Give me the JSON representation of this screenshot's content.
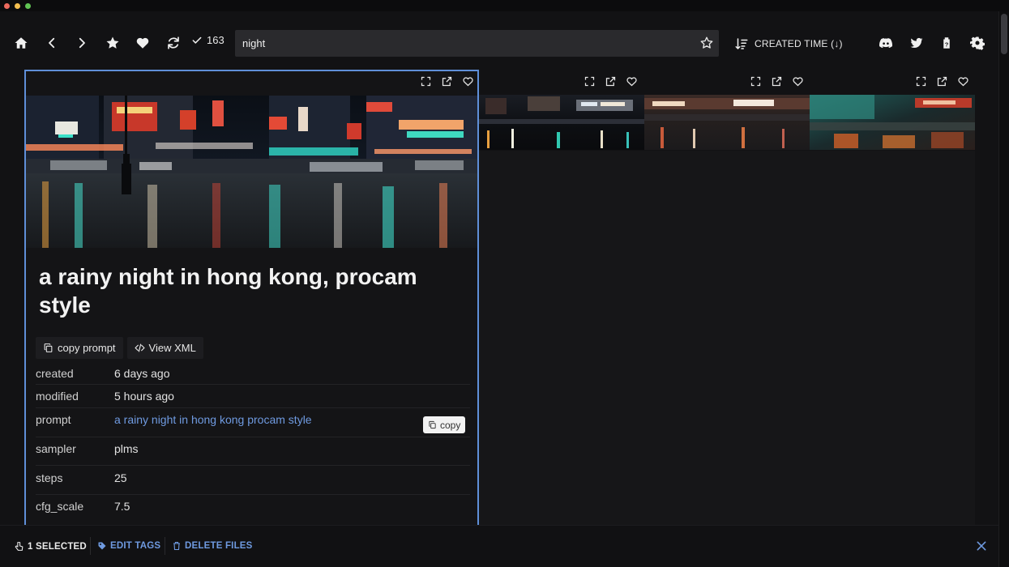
{
  "window": {
    "traffic_lights": [
      "#ed6a5e",
      "#f4bf4f",
      "#61c554"
    ]
  },
  "toolbar": {
    "icons": [
      "home-icon",
      "chevron-left-icon",
      "chevron-right-icon",
      "star-icon",
      "heart-icon",
      "refresh-icon"
    ],
    "check_count": "163",
    "search_value": "night",
    "sort_label": "CREATED TIME (↓)",
    "right_icons": [
      "discord-icon",
      "twitter-icon",
      "help-icon",
      "gear-icon"
    ]
  },
  "selected_card": {
    "title": "a rainy night in hong kong, procam style",
    "actions": {
      "copy_prompt": "copy prompt",
      "view_xml": "View XML"
    },
    "meta": [
      {
        "key": "created",
        "value": "6 days ago"
      },
      {
        "key": "modified",
        "value": "5 hours ago"
      },
      {
        "key": "prompt",
        "value": "a rainy night in hong kong procam style",
        "copy_label": "copy"
      },
      {
        "key": "sampler",
        "value": "plms"
      },
      {
        "key": "steps",
        "value": "25"
      },
      {
        "key": "cfg_scale",
        "value": "7.5"
      }
    ],
    "card_icons": [
      "fullscreen-icon",
      "external-link-icon",
      "heart-outline-icon"
    ]
  },
  "thumbnails_count_shown": 3,
  "bottom_bar": {
    "selected": "1 SELECTED",
    "edit_tags": "EDIT TAGS",
    "delete_files": "DELETE FILES"
  },
  "colors": {
    "accent": "#5f8fd8",
    "link": "#6f9ae0",
    "background": "#121214"
  }
}
